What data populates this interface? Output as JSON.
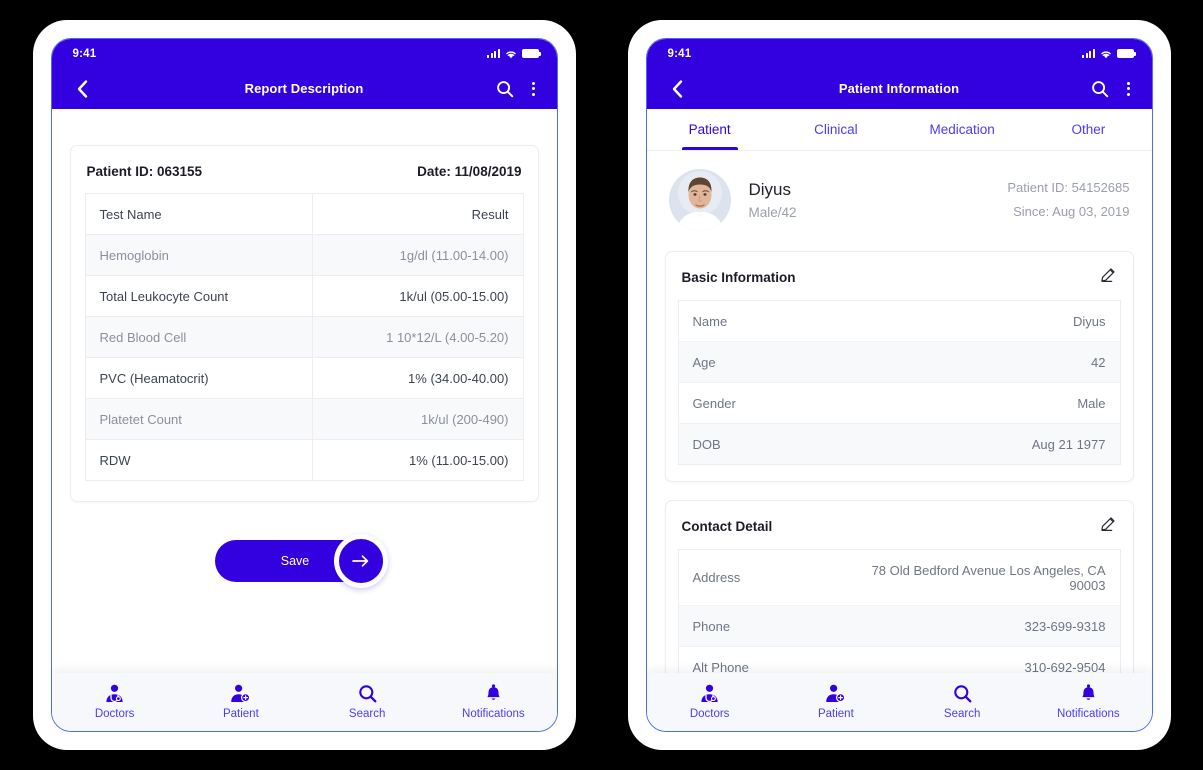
{
  "colors": {
    "brand": "#3300e0",
    "accent": "#4b3df0",
    "page_bg": "#000000",
    "phone_bg": "#ffffff",
    "row_alt": "#f8f9fb",
    "muted_text": "#9b9fab"
  },
  "phones": [
    {
      "status_bar": {
        "time": "9:41",
        "signal_icon": "signal-bars-icon",
        "wifi_icon": "wifi-icon",
        "battery_icon": "battery-icon"
      },
      "app_bar": {
        "back_icon": "chevron-left-icon",
        "title": "Report Description",
        "search_icon": "search-icon",
        "overflow_icon": "more-vertical-icon"
      },
      "report": {
        "patient_id": "Patient ID: 063155",
        "date": "Date: 11/08/2019",
        "table": {
          "columns": [
            "Test Name",
            "Result"
          ],
          "rows": [
            {
              "name": "Hemoglobin",
              "result": "1g/dl (11.00-14.00)"
            },
            {
              "name": "Total Leukocyte Count",
              "result": "1k/ul (05.00-15.00)"
            },
            {
              "name": "Red Blood Cell",
              "result": "1 10*12/L (4.00-5.20)"
            },
            {
              "name": "PVC (Heamatocrit)",
              "result": "1% (34.00-40.00)"
            },
            {
              "name": "Platetet Count",
              "result": "1k/ul (200-490)"
            },
            {
              "name": "RDW",
              "result": "1% (11.00-15.00)"
            }
          ]
        },
        "save_label": "Save",
        "save_fab_icon": "arrow-right-icon"
      },
      "bottom_nav": [
        {
          "label": "Doctors",
          "icon": "doctor-icon"
        },
        {
          "label": "Patient",
          "icon": "patient-add-icon"
        },
        {
          "label": "Search",
          "icon": "search-icon"
        },
        {
          "label": "Notifications",
          "icon": "bell-icon"
        }
      ]
    },
    {
      "status_bar": {
        "time": "9:41",
        "signal_icon": "signal-bars-icon",
        "wifi_icon": "wifi-icon",
        "battery_icon": "battery-icon"
      },
      "app_bar": {
        "back_icon": "chevron-left-icon",
        "title": "Patient Information",
        "search_icon": "search-icon",
        "overflow_icon": "more-vertical-icon"
      },
      "tabs": [
        {
          "label": "Patient",
          "active": true
        },
        {
          "label": "Clinical",
          "active": false
        },
        {
          "label": "Medication",
          "active": false
        },
        {
          "label": "Other",
          "active": false
        }
      ],
      "profile": {
        "avatar_icon": "patient-photo-avatar",
        "name": "Diyus",
        "sub": "Male/42",
        "patient_id": "Patient ID: 54152685",
        "since": "Since: Aug 03, 2019"
      },
      "sections": [
        {
          "title": "Basic Information",
          "edit_icon": "pencil-edit-icon",
          "rows": [
            {
              "key": "Name",
              "value": "Diyus"
            },
            {
              "key": "Age",
              "value": "42"
            },
            {
              "key": "Gender",
              "value": "Male"
            },
            {
              "key": "DOB",
              "value": "Aug 21 1977"
            }
          ]
        },
        {
          "title": "Contact Detail",
          "edit_icon": "pencil-edit-icon",
          "rows": [
            {
              "key": "Address",
              "value": "78 Old Bedford Avenue Los Angeles, CA 90003"
            },
            {
              "key": "Phone",
              "value": "323-699-9318"
            },
            {
              "key": "Alt Phone",
              "value": "310-692-9504"
            }
          ]
        }
      ],
      "bottom_nav": [
        {
          "label": "Doctors",
          "icon": "doctor-icon"
        },
        {
          "label": "Patient",
          "icon": "patient-add-icon"
        },
        {
          "label": "Search",
          "icon": "search-icon"
        },
        {
          "label": "Notifications",
          "icon": "bell-icon"
        }
      ]
    }
  ]
}
